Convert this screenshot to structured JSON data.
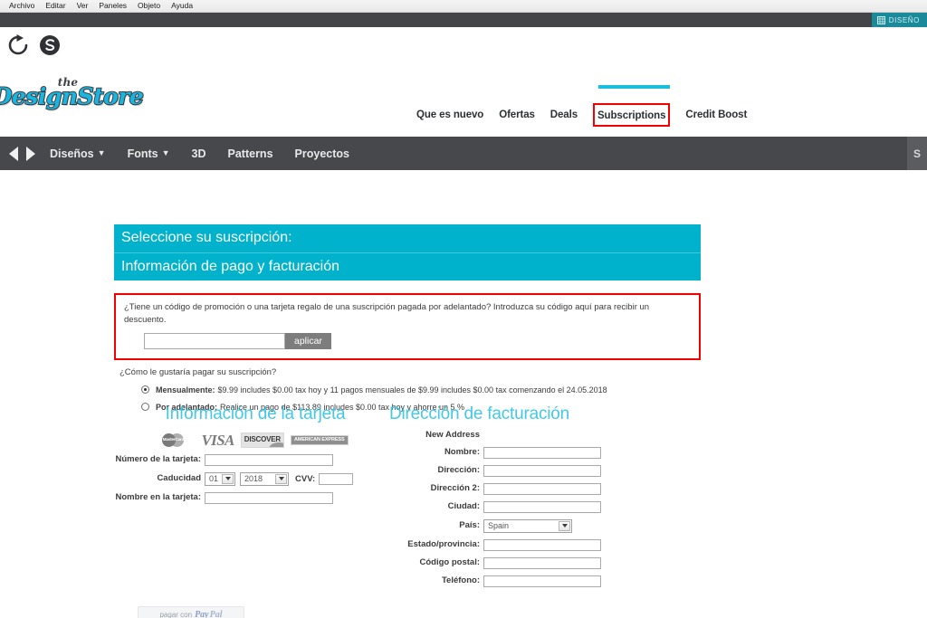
{
  "os": {
    "menu_items": [
      "Archivo",
      "Editar",
      "Ver",
      "Paneles",
      "Objeto",
      "Ayuda"
    ],
    "workspace_button": "DISEÑO",
    "workspace_icon": "grid-icon"
  },
  "toolbar": {
    "refresh_icon": "refresh-icon",
    "stop_icon": "stop-icon"
  },
  "brand": {
    "prefix": "the",
    "name": "DesignStore"
  },
  "site_nav": {
    "items": [
      {
        "label": "Que es nuevo",
        "active": false
      },
      {
        "label": "Ofertas",
        "active": false
      },
      {
        "label": "Deals",
        "active": false
      },
      {
        "label": "Subscriptions",
        "active": true
      },
      {
        "label": "Credit Boost",
        "active": false
      }
    ],
    "accent_color": "#1bbfdd",
    "highlight_color": "#f40000"
  },
  "category_nav": {
    "back_icon": "arrow-left-icon",
    "forward_icon": "arrow-right-icon",
    "items": [
      {
        "label": "Diseños",
        "has_caret": true
      },
      {
        "label": "Fonts",
        "has_caret": true
      },
      {
        "label": "3D",
        "has_caret": false
      },
      {
        "label": "Patterns",
        "has_caret": false
      },
      {
        "label": "Proyectos",
        "has_caret": false
      }
    ],
    "edge_label": "S"
  },
  "panel": {
    "header_1": "Seleccione su suscripción:",
    "header_2": "Información de pago y facturación",
    "header_color": "#00b2cc"
  },
  "promo": {
    "text": "¿Tiene un código de promoción o una tarjeta regalo de una suscripción pagada por adelantado? Introduzca su código aquí para recibir un descuento.",
    "input_value": "",
    "input_placeholder": "",
    "apply_label": "aplicar",
    "border_color": "#f40000"
  },
  "payment_choice": {
    "question": "¿Cómo le gustaría pagar su suscripción?",
    "options": [
      {
        "id": "monthly",
        "label": "Mensualmente:",
        "detail": "$9.99 includes $0.00 tax hoy y 11 pagos mensuales de $9.99 includes $0.00 tax  comenzando el 24.05.2018",
        "selected": true
      },
      {
        "id": "upfront",
        "label": "Por adelantado:",
        "detail": "Realice un pago de $113.89 includes $0.00 tax  hoy y ahorre un 5 %",
        "selected": false
      }
    ]
  },
  "card_section": {
    "title": "Información de la tarjeta",
    "accepted_cards": [
      "MasterCard",
      "VISA",
      "DISCOVER",
      "AMERICAN EXPRESS"
    ],
    "fields": {
      "number_label": "Número de la tarjeta:",
      "number_value": "",
      "expiry_label": "Caducidad",
      "expiry_month": "01",
      "expiry_year": "2018",
      "cvv_label": "CVV:",
      "cvv_value": "",
      "name_label": "Nombre en la tarjeta:",
      "name_value": ""
    },
    "paypal_button": {
      "prefix": "pagar con",
      "brand_pay": "Pay",
      "brand_pal": "Pal"
    }
  },
  "billing_section": {
    "title": "Dirección de facturación",
    "subtitle": "New Address",
    "fields": [
      {
        "label": "Nombre:",
        "value": "",
        "type": "text"
      },
      {
        "label": "Dirección:",
        "value": "",
        "type": "text"
      },
      {
        "label": "Dirección 2:",
        "value": "",
        "type": "text"
      },
      {
        "label": "Ciudad:",
        "value": "",
        "type": "text"
      },
      {
        "label": "País:",
        "value": "Spain",
        "type": "select"
      },
      {
        "label": "Estado/provincia:",
        "value": "",
        "type": "text"
      },
      {
        "label": "Código postal:",
        "value": "",
        "type": "text"
      },
      {
        "label": "Teléfono:",
        "value": "",
        "type": "text"
      }
    ]
  }
}
